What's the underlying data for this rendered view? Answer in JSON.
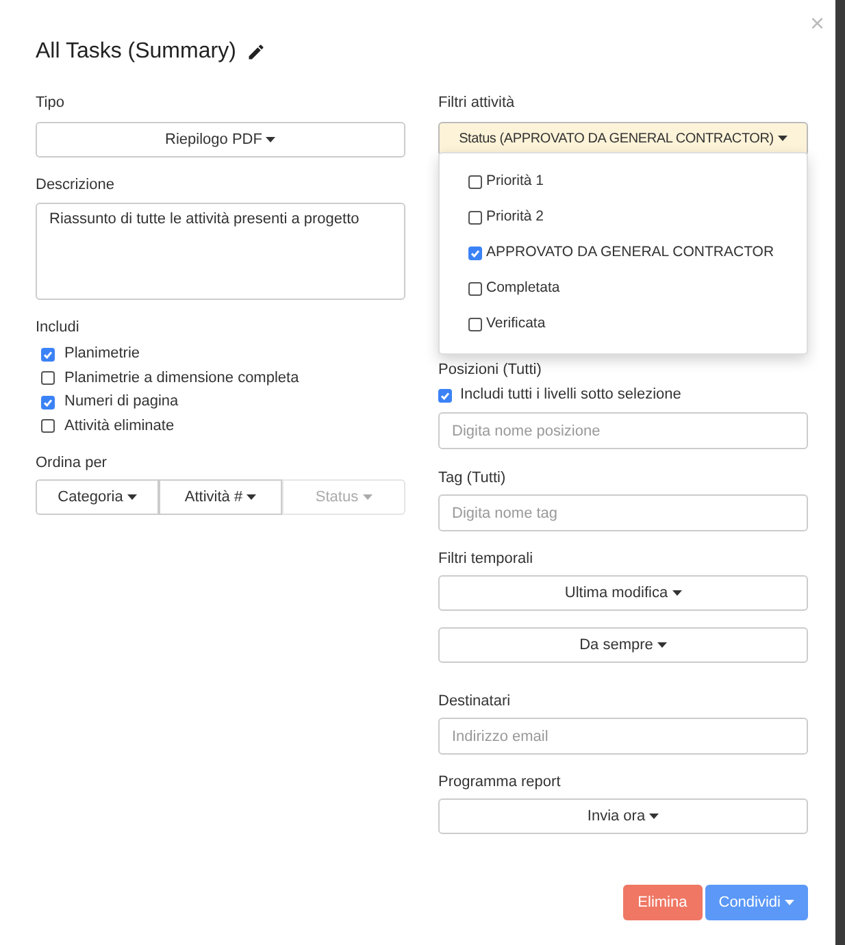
{
  "dialog": {
    "title": "All Tasks (Summary)",
    "close": "×"
  },
  "left": {
    "type": {
      "label": "Tipo",
      "value": "Riepilogo PDF"
    },
    "description": {
      "label": "Descrizione",
      "value": "Riassunto di tutte le attività presenti a progetto"
    },
    "include": {
      "label": "Includi",
      "options": [
        {
          "label": "Planimetrie",
          "checked": true
        },
        {
          "label": "Planimetrie a dimensione completa",
          "checked": false
        },
        {
          "label": "Numeri di pagina",
          "checked": true
        },
        {
          "label": "Attività eliminate",
          "checked": false
        }
      ]
    },
    "sort": {
      "label": "Ordina per",
      "buttons": [
        {
          "label": "Categoria",
          "disabled": false
        },
        {
          "label": "Attività #",
          "disabled": false
        },
        {
          "label": "Status",
          "disabled": true
        }
      ]
    }
  },
  "right": {
    "task_filters": {
      "label": "Filtri attività",
      "value": "Status (APPROVATO DA GENERAL CONTRACTOR)",
      "menu": [
        {
          "label": "Priorità 1",
          "checked": false
        },
        {
          "label": "Priorità 2",
          "checked": false
        },
        {
          "label": "APPROVATO DA GENERAL CONTRACTOR",
          "checked": true
        },
        {
          "label": "Completata",
          "checked": false
        },
        {
          "label": "Verificata",
          "checked": false
        }
      ]
    },
    "positions": {
      "label": "Posizioni (Tutti)",
      "include_sublevels": {
        "label": "Includi tutti i livelli sotto selezione",
        "checked": true
      },
      "placeholder": "Digita nome posizione"
    },
    "tags": {
      "label": "Tag (Tutti)",
      "placeholder": "Digita nome tag"
    },
    "time_filters": {
      "label": "Filtri temporali",
      "buttons": [
        "Ultima modifica",
        "Da sempre"
      ]
    },
    "recipients": {
      "label": "Destinatari",
      "placeholder": "Indirizzo email"
    },
    "schedule": {
      "label": "Programma report",
      "value": "Invia ora"
    }
  },
  "footer": {
    "delete": "Elimina",
    "share": "Condividi"
  }
}
